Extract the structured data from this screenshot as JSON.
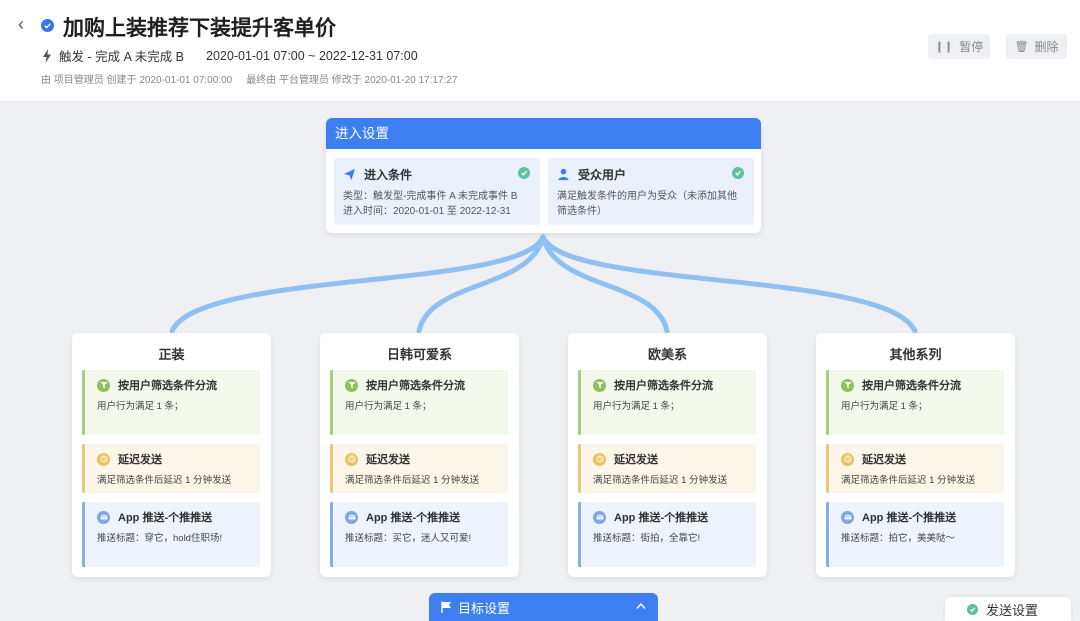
{
  "header": {
    "title": "加购上装推荐下装提升客单价",
    "trigger": "触发 - 完成 A 未完成 B",
    "period": "2020-01-01 07:00 ~ 2022-12-31 07:00",
    "created": "由 项目管理员 创建于 2020-01-01 07:00:00",
    "modified": "最终由 平台管理员 修改于 2020-01-20 17:17:27",
    "pause_label": "暂停",
    "delete_label": "删除"
  },
  "entry": {
    "title": "进入设置",
    "condition": {
      "title": "进入条件",
      "type_text": "类型：触发型-完成事件 A 未完成事件 B",
      "time_text": "进入时间：2020-01-01 至 2022-12-31"
    },
    "audience": {
      "title": "受众用户",
      "text_line1": "满足触发条件的用户为受众（未添加其他",
      "text_line2": "筛选条件）"
    }
  },
  "branches": [
    {
      "name": "正装",
      "filter_title": "按用户筛选条件分流",
      "filter_text": "用户行为满足 1 条；",
      "delay_title": "延迟发送",
      "delay_text": "满足筛选条件后延迟 1 分钟发送",
      "push_title": "App 推送-个推推送",
      "push_text": "推送标题：穿它，hold住职场!"
    },
    {
      "name": "日韩可爱系",
      "filter_title": "按用户筛选条件分流",
      "filter_text": "用户行为满足 1 条；",
      "delay_title": "延迟发送",
      "delay_text": "满足筛选条件后延迟 1 分钟发送",
      "push_title": "App 推送-个推推送",
      "push_text": "推送标题：买它，迷人又可爱!"
    },
    {
      "name": "欧美系",
      "filter_title": "按用户筛选条件分流",
      "filter_text": "用户行为满足 1 条；",
      "delay_title": "延迟发送",
      "delay_text": "满足筛选条件后延迟 1 分钟发送",
      "push_title": "App 推送-个推推送",
      "push_text": "推送标题：街拍，全靠它!"
    },
    {
      "name": "其他系列",
      "filter_title": "按用户筛选条件分流",
      "filter_text": "用户行为满足 1 条；",
      "delay_title": "延迟发送",
      "delay_text": "满足筛选条件后延迟 1 分钟发送",
      "push_title": "App 推送-个推推送",
      "push_text": "推送标题：拍它，美美哒～"
    }
  ],
  "goal": {
    "title": "目标设置"
  },
  "send": {
    "title": "发送设置"
  },
  "colors": {
    "primary": "#3d7ff0",
    "connector": "#8fc0f2",
    "success": "#5cc39d",
    "filter": "#8cc05a",
    "delay": "#f2bf5e",
    "push": "#7ea6ea"
  }
}
